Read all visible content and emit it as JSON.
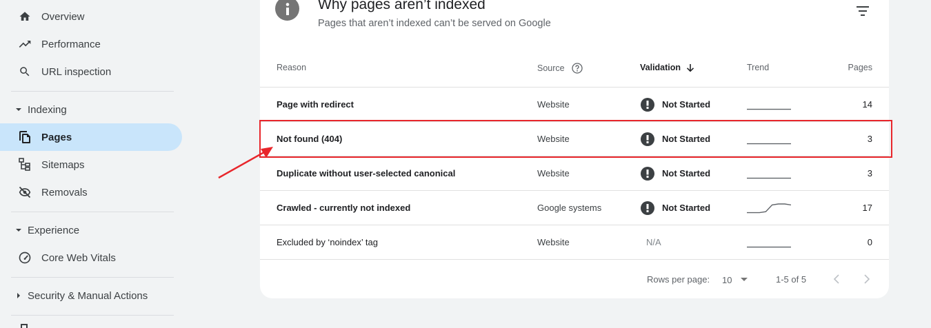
{
  "sidebar": {
    "items": [
      {
        "label": "Overview",
        "icon": "home-icon"
      },
      {
        "label": "Performance",
        "icon": "trending-up-icon"
      },
      {
        "label": "URL inspection",
        "icon": "search-icon"
      }
    ],
    "indexing": {
      "label": "Indexing",
      "items": [
        {
          "label": "Pages",
          "icon": "pages-icon",
          "active": true
        },
        {
          "label": "Sitemaps",
          "icon": "sitemap-icon"
        },
        {
          "label": "Removals",
          "icon": "visibility-off-icon"
        }
      ]
    },
    "experience": {
      "label": "Experience",
      "items": [
        {
          "label": "Core Web Vitals",
          "icon": "speed-gauge-icon"
        }
      ]
    },
    "security": {
      "label": "Security & Manual Actions"
    }
  },
  "card": {
    "title": "Why pages aren’t indexed",
    "subtitle": "Pages that aren’t indexed can’t be served on Google",
    "columns": {
      "reason": "Reason",
      "source": "Source",
      "validation": "Validation",
      "trend": "Trend",
      "pages": "Pages"
    },
    "rows": [
      {
        "reason": "Page with redirect",
        "source": "Website",
        "validation": "Not Started",
        "pages": "14",
        "trend": [
          1,
          1,
          1,
          1,
          1,
          1,
          1,
          1
        ]
      },
      {
        "reason": "Not found (404)",
        "source": "Website",
        "validation": "Not Started",
        "pages": "3",
        "trend": [
          1,
          1,
          1,
          1,
          1,
          1,
          1,
          1
        ]
      },
      {
        "reason": "Duplicate without user-selected canonical",
        "source": "Website",
        "validation": "Not Started",
        "pages": "3",
        "trend": [
          1,
          1,
          1,
          1,
          1,
          1,
          1,
          1
        ]
      },
      {
        "reason": "Crawled - currently not indexed",
        "source": "Google systems",
        "validation": "Not Started",
        "pages": "17",
        "trend": [
          1,
          1,
          1,
          2,
          9,
          10,
          10,
          9
        ]
      },
      {
        "reason": "Excluded by ‘noindex’ tag",
        "source": "Website",
        "validation": "N/A",
        "pages": "0",
        "trend": [
          1,
          1,
          1,
          1,
          1,
          1,
          1,
          1
        ]
      }
    ],
    "footer": {
      "rows_per_page_label": "Rows per page:",
      "rows_per_page_value": "10",
      "range": "1-5 of 5"
    }
  },
  "colors": {
    "active_nav": "#c9e5fb",
    "highlight": "#e8262b",
    "card_bg": "#ffffff",
    "page_bg": "#f1f3f4"
  }
}
